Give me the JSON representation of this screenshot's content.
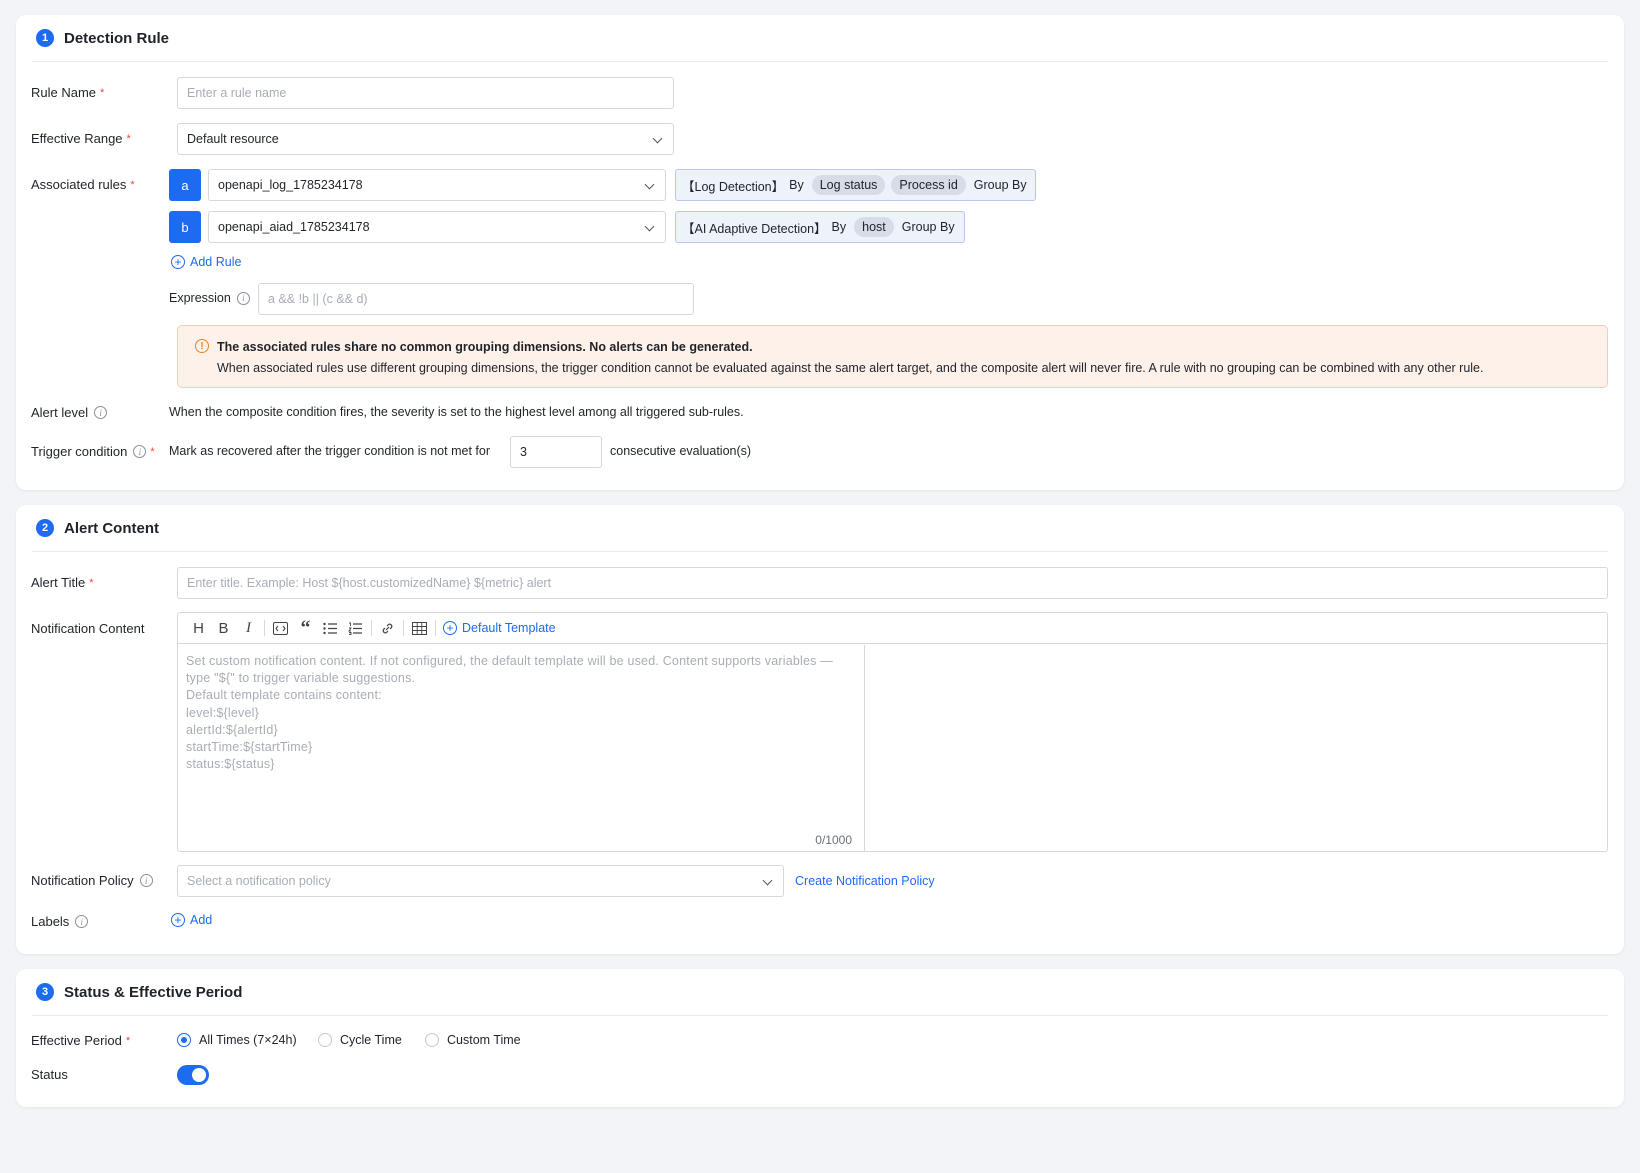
{
  "sections": {
    "detection": {
      "num": "1",
      "title": "Detection Rule"
    },
    "content": {
      "num": "2",
      "title": "Alert Content"
    },
    "status": {
      "num": "3",
      "title": "Status & Effective Period"
    }
  },
  "rule_name": {
    "label": "Rule Name",
    "placeholder": "Enter a rule name"
  },
  "effective_range": {
    "label": "Effective Range",
    "value": "Default resource"
  },
  "associated_rules": {
    "label": "Associated rules",
    "items": [
      {
        "letter": "a",
        "value": "openapi_log_1785234178",
        "type": "【Log Detection】",
        "by": "By",
        "tags": [
          "Log status",
          "Process id"
        ],
        "group": "Group By"
      },
      {
        "letter": "b",
        "value": "openapi_aiad_1785234178",
        "type": "【AI Adaptive Detection】",
        "by": "By",
        "tags": [
          "host"
        ],
        "group": "Group By"
      }
    ],
    "add_rule": "Add Rule"
  },
  "expression": {
    "label": "Expression",
    "placeholder": "a && !b || (c && d)"
  },
  "warning": {
    "title": "The associated rules share no common grouping dimensions. No alerts can be generated.",
    "body": "When associated rules use different grouping dimensions, the trigger condition cannot be evaluated against the same alert target, and the composite alert will never fire. A rule with no grouping can be combined with any other rule."
  },
  "alert_level": {
    "label": "Alert level",
    "text": "When the composite condition fires, the severity is set to the highest level among all triggered sub-rules."
  },
  "trigger": {
    "label": "Trigger condition",
    "prefix": "Mark as recovered after the trigger condition is not met for",
    "value": "3",
    "suffix": "consecutive evaluation(s)"
  },
  "alert_title": {
    "label": "Alert Title",
    "placeholder": "Enter title. Example: Host ${host.customizedName} ${metric} alert"
  },
  "notification_content": {
    "label": "Notification Content",
    "default_template": "Default Template",
    "placeholder": "Set custom notification content. If not configured, the default template will be used. Content supports variables — type \"${\" to trigger variable suggestions.\nDefault template contains content:\nlevel:${level}\nalertId:${alertId}\nstartTime:${startTime}\nstatus:${status}",
    "counter": "0/1000"
  },
  "notification_policy": {
    "label": "Notification Policy",
    "placeholder": "Select a notification policy",
    "create": "Create Notification Policy"
  },
  "labels": {
    "label": "Labels",
    "add": "Add"
  },
  "effective_period": {
    "label": "Effective Period",
    "options": [
      "All Times (7×24h)",
      "Cycle Time",
      "Custom Time"
    ],
    "selected": "All Times (7×24h)"
  },
  "status": {
    "label": "Status",
    "enabled": true
  },
  "colors": {
    "accent": "#1c6bf0",
    "warning_bg": "#fdf1ea",
    "warning_icon": "#f07f21",
    "required": "#f04438"
  }
}
